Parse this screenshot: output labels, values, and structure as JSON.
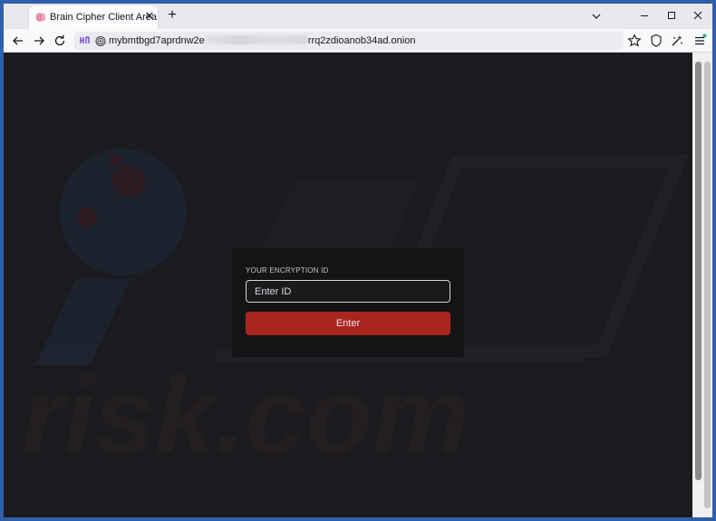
{
  "browser": {
    "tab": {
      "title": "Brain Cipher Client Area",
      "favicon": "brain-cipher-favicon"
    },
    "url": {
      "prefix": "mybmtbgd7aprdnw2e",
      "suffix": "rrq2zdioanob34ad.onion"
    }
  },
  "page": {
    "label": "YOUR ENCRYPTION ID",
    "input_placeholder": "Enter ID",
    "button_label": "Enter",
    "watermark_text": "risk.com"
  },
  "colors": {
    "page_bg": "#1b1b1f",
    "card_bg": "#141416",
    "button": "#a8261f",
    "window_frame": "#2f5fa8"
  }
}
